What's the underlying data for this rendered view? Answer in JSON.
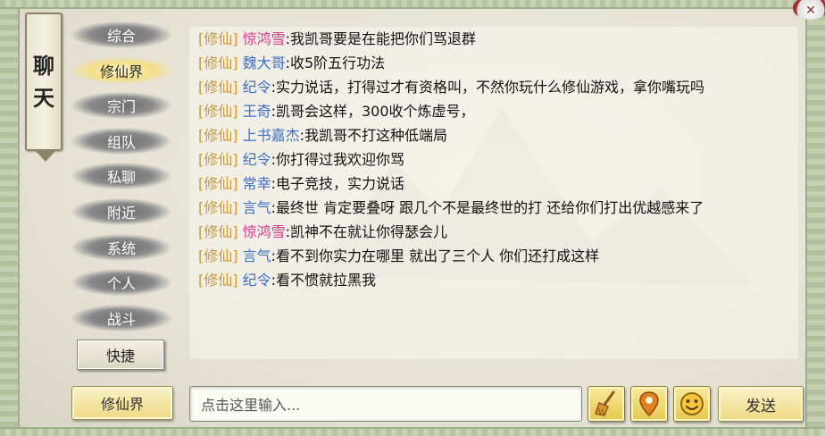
{
  "window": {
    "title_chars": [
      "聊",
      "天"
    ],
    "close_icon": "close-icon"
  },
  "tabs": [
    {
      "label": "综合",
      "active": false
    },
    {
      "label": "修仙界",
      "active": true
    },
    {
      "label": "宗门",
      "active": false
    },
    {
      "label": "组队",
      "active": false
    },
    {
      "label": "私聊",
      "active": false
    },
    {
      "label": "附近",
      "active": false
    },
    {
      "label": "系统",
      "active": false
    },
    {
      "label": "个人",
      "active": false
    },
    {
      "label": "战斗",
      "active": false
    },
    {
      "label": "快捷",
      "active": false
    }
  ],
  "messages": [
    {
      "channel": "[修仙]",
      "name": "惊鸿雪",
      "name_color": "pink",
      "text": ":我凯哥要是在能把你们骂退群"
    },
    {
      "channel": "[修仙]",
      "name": "魏大哥",
      "name_color": "blue",
      "text": ":收5阶五行功法"
    },
    {
      "channel": "[修仙]",
      "name": "纪令",
      "name_color": "blue",
      "text": ":实力说话，打得过才有资格叫，不然你玩什么修仙游戏，拿你嘴玩吗"
    },
    {
      "channel": "[修仙]",
      "name": "王奇",
      "name_color": "blue",
      "text": ":凯哥会这样，300收个炼虚号，"
    },
    {
      "channel": "[修仙]",
      "name": "上书嘉杰",
      "name_color": "blue",
      "text": ":我凯哥不打这种低端局"
    },
    {
      "channel": "[修仙]",
      "name": "纪令",
      "name_color": "blue",
      "text": ":你打得过我欢迎你骂"
    },
    {
      "channel": "[修仙]",
      "name": "常幸",
      "name_color": "blue",
      "text": ":电子竞技，实力说话"
    },
    {
      "channel": "[修仙]",
      "name": "言气",
      "name_color": "blue",
      "text": ":最终世 肯定要叠呀 跟几个不是最终世的打 还给你们打出优越感来了"
    },
    {
      "channel": "[修仙]",
      "name": "惊鸿雪",
      "name_color": "pink",
      "text": ":凯神不在就让你得瑟会儿"
    },
    {
      "channel": "[修仙]",
      "name": "言气",
      "name_color": "blue",
      "text": ":看不到你实力在哪里 就出了三个人 你们还打成这样"
    },
    {
      "channel": "[修仙]",
      "name": "纪令",
      "name_color": "blue",
      "text": ":看不惯就拉黑我"
    }
  ],
  "bottom": {
    "channel_label": "修仙界",
    "input_placeholder": "点击这里输入...",
    "send_label": "发送",
    "icons": [
      "broom-icon",
      "location-pin-icon",
      "smiley-icon"
    ]
  },
  "colors": {
    "channel": "#c79a3c",
    "name_pink": "#d63b8f",
    "name_blue": "#3e6fc6",
    "active_tab": "#f4df86"
  }
}
